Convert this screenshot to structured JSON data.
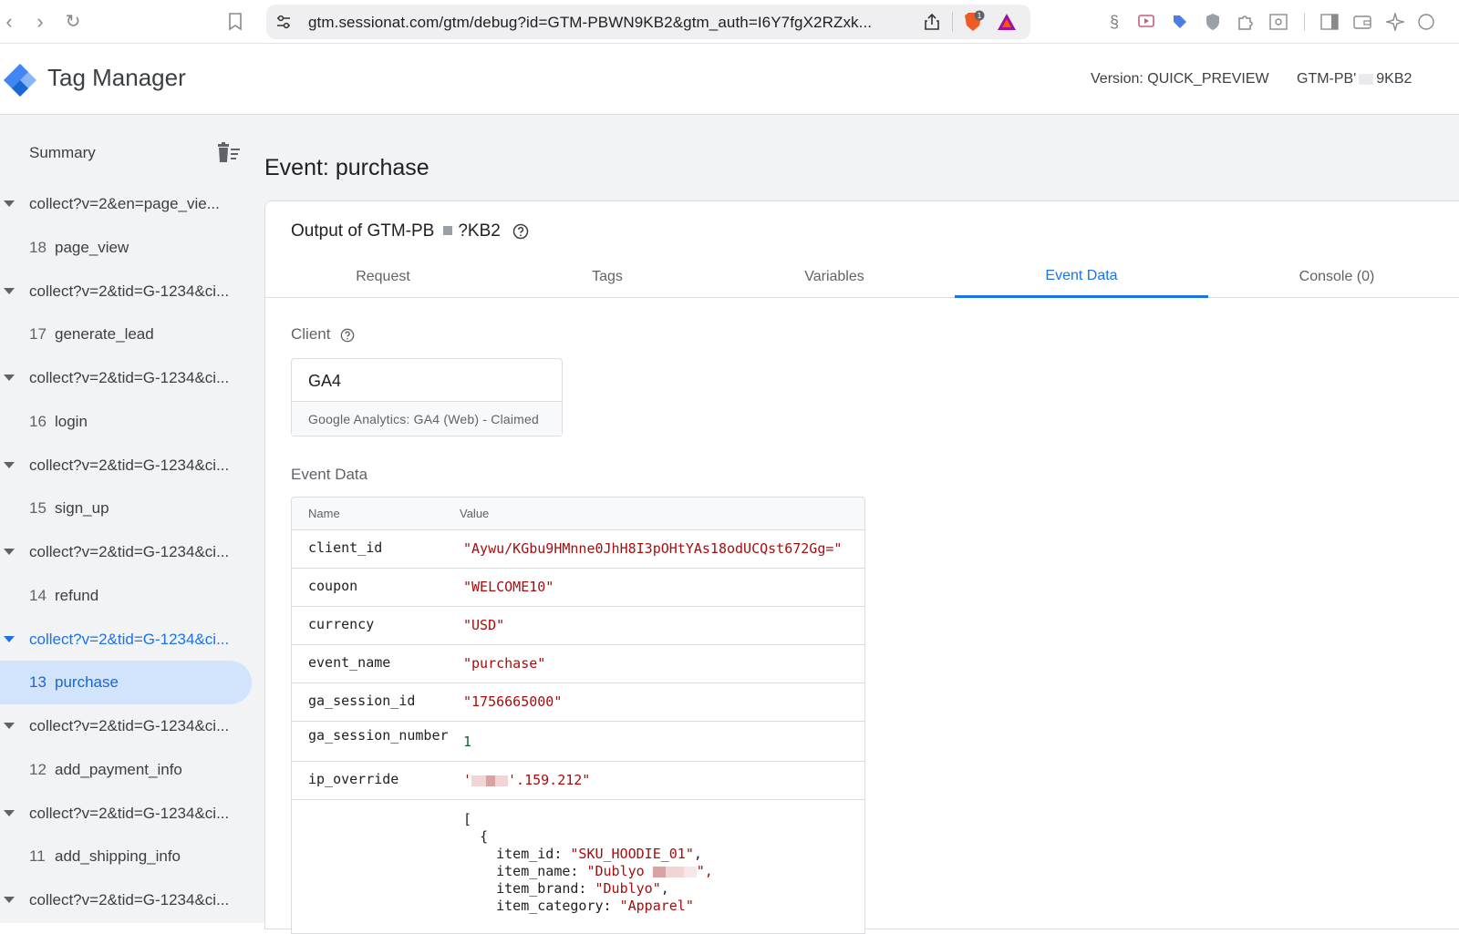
{
  "browser": {
    "url": "gtm.sessionat.com/gtm/debug?id=GTM-PBWN9KB2&gtm_auth=I6Y7fgX2RZxk...",
    "shield_count": "1"
  },
  "header": {
    "app_title": "Tag Manager",
    "version": "Version: QUICK_PREVIEW",
    "container_prefix": "GTM-PB'",
    "container_suffix": "9KB2"
  },
  "sidebar": {
    "summary_label": "Summary",
    "items": [
      {
        "type": "group",
        "label": "collect?v=2&en=page_vie..."
      },
      {
        "type": "event",
        "num": "18",
        "label": "page_view"
      },
      {
        "type": "group",
        "label": "collect?v=2&tid=G-1234&ci..."
      },
      {
        "type": "event",
        "num": "17",
        "label": "generate_lead"
      },
      {
        "type": "group",
        "label": "collect?v=2&tid=G-1234&ci..."
      },
      {
        "type": "event",
        "num": "16",
        "label": "login"
      },
      {
        "type": "group",
        "label": "collect?v=2&tid=G-1234&ci..."
      },
      {
        "type": "event",
        "num": "15",
        "label": "sign_up"
      },
      {
        "type": "group",
        "label": "collect?v=2&tid=G-1234&ci..."
      },
      {
        "type": "event",
        "num": "14",
        "label": "refund"
      },
      {
        "type": "group",
        "label": "collect?v=2&tid=G-1234&ci..."
      },
      {
        "type": "event",
        "num": "13",
        "label": "purchase"
      },
      {
        "type": "group",
        "label": "collect?v=2&tid=G-1234&ci..."
      },
      {
        "type": "event",
        "num": "12",
        "label": "add_payment_info"
      },
      {
        "type": "group",
        "label": "collect?v=2&tid=G-1234&ci..."
      },
      {
        "type": "event",
        "num": "11",
        "label": "add_shipping_info"
      },
      {
        "type": "group",
        "label": "collect?v=2&tid=G-1234&ci..."
      }
    ]
  },
  "main": {
    "event_title": "Event: purchase",
    "output_prefix": "Output of GTM-PB",
    "output_suffix": "?KB2",
    "tabs": [
      "Request",
      "Tags",
      "Variables",
      "Event Data",
      "Console (0)"
    ],
    "active_tab": "Event Data",
    "client_label": "Client",
    "client_name": "GA4",
    "client_desc": "Google Analytics: GA4 (Web) - Claimed",
    "event_data_label": "Event Data",
    "table": {
      "col_name": "Name",
      "col_value": "Value",
      "rows": [
        {
          "name": "client_id",
          "value": "\"Aywu/KGbu9HMnne0JhH8I3pOHtYAs18odUCQst672Gg=\""
        },
        {
          "name": "coupon",
          "value": "\"WELCOME10\""
        },
        {
          "name": "currency",
          "value": "\"USD\""
        },
        {
          "name": "event_name",
          "value": "\"purchase\""
        },
        {
          "name": "ga_session_id",
          "value": "\"1756665000\""
        },
        {
          "name": "ga_session_number",
          "value": "1"
        },
        {
          "name": "ip_override",
          "value_prefix": "'",
          "value_suffix": "'.159.212\""
        }
      ],
      "items": {
        "open_bracket": "[",
        "open_brace": "{",
        "item_id_key": "item_id: ",
        "item_id_val": "\"SKU_HOODIE_01\"",
        "item_name_key": "item_name: ",
        "item_name_val_prefix": "\"Dublyo",
        "item_name_val_suffix": "\",",
        "item_brand_key": "item_brand: ",
        "item_brand_val": "\"Dublyo\"",
        "item_category_key": "item_category: ",
        "item_category_val": "\"Apparel\""
      }
    }
  },
  "colors": {
    "accent": "#1a73e8",
    "selected_bg": "#d2e3fc",
    "string_value": "#a50e0e",
    "number_value": "#0d652d"
  }
}
